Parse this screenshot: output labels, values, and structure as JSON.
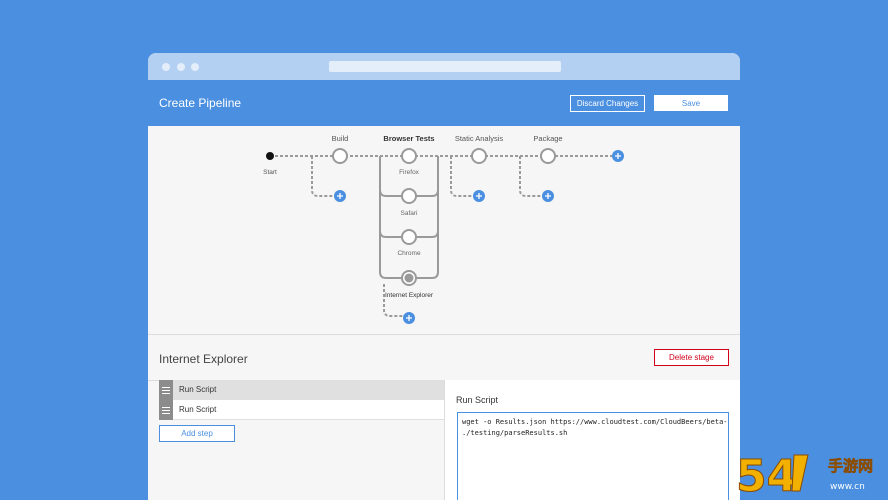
{
  "header": {
    "title": "Create Pipeline",
    "discard_label": "Discard Changes",
    "save_label": "Save"
  },
  "pipeline": {
    "start_label": "Start",
    "stages": [
      "Build",
      "Browser Tests",
      "Static Analysis",
      "Package"
    ],
    "parallel_nodes": [
      "Firefox",
      "Safari",
      "Chrome",
      "Internet Explorer"
    ]
  },
  "stage_detail": {
    "title": "Internet Explorer",
    "delete_label": "Delete stage"
  },
  "steps": {
    "items": [
      "Run Script",
      "Run Script"
    ],
    "add_label": "Add step"
  },
  "script": {
    "title": "Run Script",
    "lines": [
      "wget -o Results.json https://www.cloudtest.com/CloudBeers/beta-p",
      "./testing/parseResults.sh"
    ]
  },
  "watermark": {
    "main": "54",
    "sub": "手游网",
    "site": "www.cn"
  },
  "colors": {
    "background": "#4a8fe0",
    "accent": "#4a8fe0",
    "danger": "#d0021b",
    "node_stroke": "#9a9a9a"
  }
}
